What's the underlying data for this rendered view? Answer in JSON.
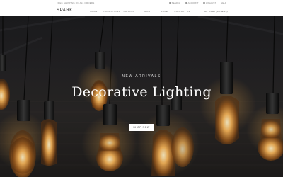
{
  "topbar": {
    "shipping": "FREE SHIPPING ON ALL ORDERS",
    "links": [
      {
        "label": "SEARCH",
        "icon": "search-icon"
      },
      {
        "label": "ACCOUNT",
        "icon": "user-icon"
      },
      {
        "label": "WISHLIST",
        "icon": "heart-icon"
      },
      {
        "label": "HELP",
        "icon": "help-icon"
      }
    ]
  },
  "navbar": {
    "logo": "SPARK",
    "menu": [
      "HOME",
      "COLLECTIONS",
      "CATALOG",
      "BLOG",
      "PAGE",
      "CONTACT US"
    ],
    "cart": "MY CART (0 ITEMS)"
  },
  "hero": {
    "kicker": "NEW ARRIVALS",
    "title": "Decorative Lighting",
    "button": "SHOP NOW"
  },
  "colors": {
    "accent": "#ffffff",
    "hero_background": "#1f1d1c",
    "bulb_glow": "#f5b45a"
  }
}
